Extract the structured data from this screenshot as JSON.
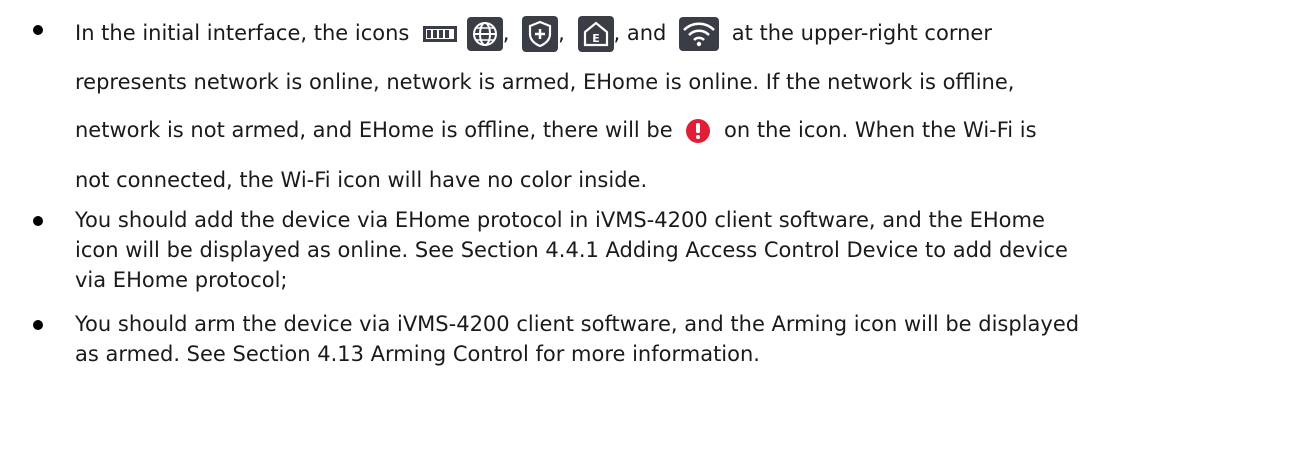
{
  "bullet1": {
    "l1_a": "In the initial interface, the icons",
    "comma_a": ",",
    "comma_b": ",",
    "and": ", and",
    "l1_b": "at the upper-right corner",
    "l2": "represents network is online, network is armed, EHome is online. If the network is offline,",
    "l3_a": "network is not armed, and EHome is offline, there will be",
    "l3_b": "on the icon. When the Wi-Fi is",
    "l4": "not connected, the Wi-Fi icon will have no color inside."
  },
  "bullet2": {
    "l1": "You should add the device via EHome protocol in iVMS-4200 client software, and the EHome",
    "l2": "icon will be displayed as online. See Section 4.4.1 Adding Access Control Device to add device",
    "l3": "via EHome protocol;"
  },
  "bullet3": {
    "l1": "You should arm the device via iVMS-4200 client software, and the Arming icon will be displayed",
    "l2": "as armed. See Section 4.13 Arming Control for more information."
  },
  "icons": [
    "battery-icon",
    "globe-network-icon",
    "shield-plus-icon",
    "home-e-icon",
    "wifi-icon",
    "alert-icon"
  ],
  "colors": {
    "icon_bg": "#3a3d45",
    "alert": "#e11d38",
    "text": "#1a1a1a"
  }
}
